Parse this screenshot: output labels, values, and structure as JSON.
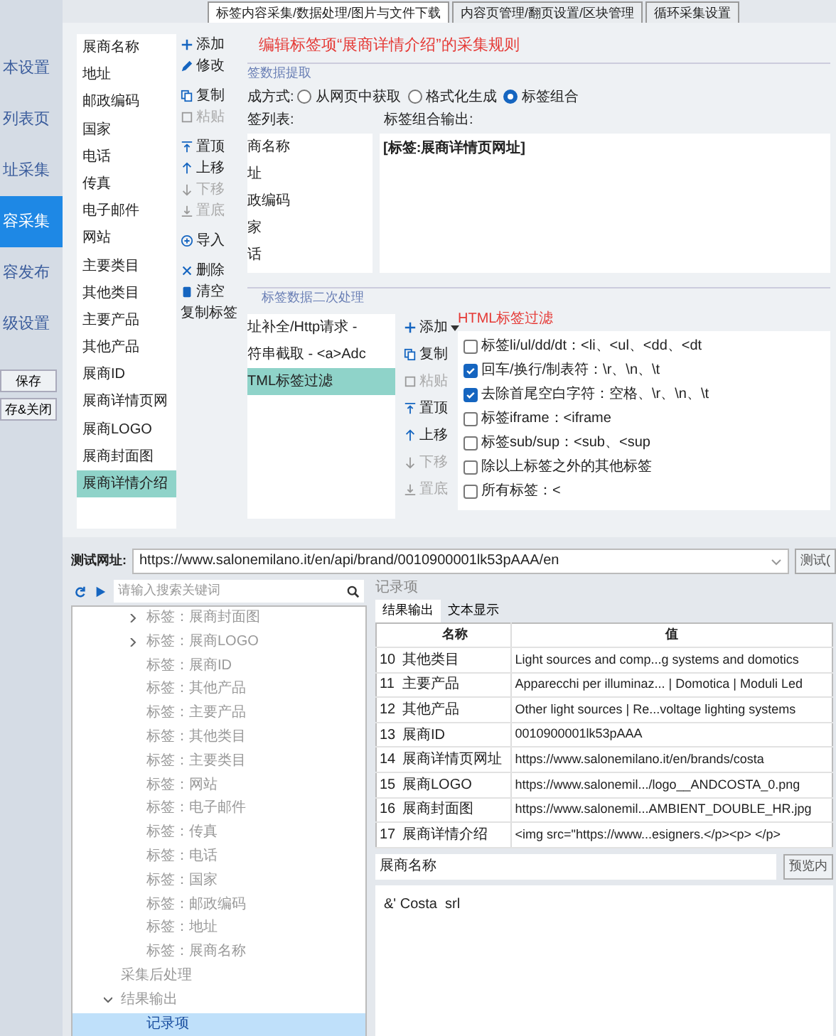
{
  "nav": {
    "items": [
      {
        "label": "本设置",
        "selected": false
      },
      {
        "label": "列表页",
        "selected": false
      },
      {
        "label": "址采集",
        "selected": false
      },
      {
        "label": "容采集",
        "selected": true
      },
      {
        "label": "容发布",
        "selected": false
      },
      {
        "label": "级设置",
        "selected": false
      }
    ],
    "buttons": [
      "保存",
      "存&关闭"
    ]
  },
  "tabs": [
    {
      "label": "标签内容采集/数据处理/图片与文件下载",
      "selected": true
    },
    {
      "label": "内容页管理/翻页设置/区块管理",
      "selected": false
    },
    {
      "label": "循环采集设置",
      "selected": false
    }
  ],
  "field_list": [
    {
      "label": "展商名称",
      "selected": false
    },
    {
      "label": "地址",
      "selected": false
    },
    {
      "label": "邮政编码",
      "selected": false
    },
    {
      "label": "国家",
      "selected": false
    },
    {
      "label": "电话",
      "selected": false
    },
    {
      "label": "传真",
      "selected": false
    },
    {
      "label": "电子邮件",
      "selected": false
    },
    {
      "label": "网站",
      "selected": false
    },
    {
      "label": "主要类目",
      "selected": false
    },
    {
      "label": "其他类目",
      "selected": false
    },
    {
      "label": "主要产品",
      "selected": false
    },
    {
      "label": "其他产品",
      "selected": false
    },
    {
      "label": "展商ID",
      "selected": false
    },
    {
      "label": "展商详情页网",
      "selected": false
    },
    {
      "label": "展商LOGO",
      "selected": false
    },
    {
      "label": "展商封面图",
      "selected": false
    },
    {
      "label": "展商详情介绍",
      "selected": true
    }
  ],
  "field_buttons": [
    {
      "label": "添加",
      "disabled": false
    },
    {
      "label": "修改",
      "disabled": false
    },
    {
      "label": "复制",
      "disabled": false
    },
    {
      "label": "粘贴",
      "disabled": true
    },
    {
      "label": "置顶",
      "disabled": false
    },
    {
      "label": "上移",
      "disabled": false
    },
    {
      "label": "下移",
      "disabled": true
    },
    {
      "label": "置底",
      "disabled": true
    },
    {
      "label": "导入",
      "disabled": false
    },
    {
      "label": "删除",
      "disabled": false
    },
    {
      "label": "清空",
      "disabled": false
    },
    {
      "label": "复制标签",
      "disabled": false
    }
  ],
  "rule_title": "编辑标签项“展商详情介绍”的采集规则",
  "extraction": {
    "legend": "签数据提取",
    "mode_label": "成方式:",
    "modes": [
      {
        "label": "从网页中获取",
        "selected": false
      },
      {
        "label": "格式化生成",
        "selected": false
      },
      {
        "label": "标签组合",
        "selected": true
      }
    ],
    "tag_list_label": "签列表:",
    "tag_list": [
      {
        "label": "商名称",
        "selected": false
      },
      {
        "label": "址",
        "selected": false
      },
      {
        "label": "政编码",
        "selected": false
      },
      {
        "label": "家",
        "selected": false
      },
      {
        "label": "话",
        "selected": false
      }
    ],
    "output_label": "标签组合输出:",
    "output": "[标签:展商详情页网址]"
  },
  "processing": {
    "legend": "标签数据二次处理",
    "steps": [
      {
        "label": "址补全/Http请求 -",
        "selected": false
      },
      {
        "label": "符串截取 - <a>Adc",
        "selected": false
      },
      {
        "label": "TML标签过滤",
        "selected": true
      }
    ],
    "buttons": [
      {
        "label": "添加",
        "disabled": false,
        "dropdown": true
      },
      {
        "label": "复制",
        "disabled": false,
        "dropdown": false
      },
      {
        "label": "粘贴",
        "disabled": true,
        "dropdown": false
      },
      {
        "label": "置顶",
        "disabled": false,
        "dropdown": false
      },
      {
        "label": "上移",
        "disabled": false,
        "dropdown": false
      },
      {
        "label": "下移",
        "disabled": true,
        "dropdown": false
      },
      {
        "label": "置底",
        "disabled": true,
        "dropdown": false
      }
    ],
    "filter_title": "HTML标签过滤",
    "filters": [
      {
        "label": "标签li/ul/dd/dt：<li、<ul、<dd、<dt",
        "checked": false
      },
      {
        "label": "回车/换行/制表符：\\r、\\n、\\t",
        "checked": true
      },
      {
        "label": "去除首尾空白字符：空格、\\r、\\n、\\t",
        "checked": true
      },
      {
        "label": "标签iframe：<iframe",
        "checked": false
      },
      {
        "label": "标签sub/sup：<sub、<sup",
        "checked": false
      },
      {
        "label": "除以上标签之外的其他标签",
        "checked": false
      },
      {
        "label": "所有标签：<",
        "checked": false
      }
    ]
  },
  "test": {
    "label": "测试网址:",
    "url": "https://www.salonemilano.it/en/api/brand/0010900001lk53pAAA/en",
    "button": "测试("
  },
  "search": {
    "placeholder": "请输入搜索关键词"
  },
  "tree": [
    {
      "label": "标签：展商封面图",
      "expanded": false,
      "selected": false
    },
    {
      "label": "标签：展商LOGO",
      "expanded": false,
      "selected": false
    },
    {
      "label": "标签：展商ID",
      "selected": false
    },
    {
      "label": "标签：其他产品",
      "selected": false
    },
    {
      "label": "标签：主要产品",
      "selected": false
    },
    {
      "label": "标签：其他类目",
      "selected": false
    },
    {
      "label": "标签：主要类目",
      "selected": false
    },
    {
      "label": "标签：网站",
      "selected": false
    },
    {
      "label": "标签：电子邮件",
      "selected": false
    },
    {
      "label": "标签：传真",
      "selected": false
    },
    {
      "label": "标签：电话",
      "selected": false
    },
    {
      "label": "标签：国家",
      "selected": false
    },
    {
      "label": "标签：邮政编码",
      "selected": false
    },
    {
      "label": "标签：地址",
      "selected": false
    },
    {
      "label": "标签：展商名称",
      "selected": false
    },
    {
      "label": "采集后处理",
      "selected": false,
      "top": true
    },
    {
      "label": "结果输出",
      "selected": false,
      "top": true,
      "expanded": true,
      "children": [
        {
          "label": "记录项",
          "selected": true
        }
      ]
    }
  ],
  "result": {
    "label": "记录项",
    "tabs": [
      {
        "label": "结果输出",
        "selected": true
      },
      {
        "label": "文本显示",
        "selected": false
      }
    ],
    "columns": [
      "",
      "名称",
      "值"
    ],
    "rows": [
      [
        "10",
        "其他类目",
        "Light sources and comp...g systems and domotics"
      ],
      [
        "11",
        "主要产品",
        "Apparecchi per illuminaz... | Domotica | Moduli Led"
      ],
      [
        "12",
        "其他产品",
        "Other light sources | Re...voltage lighting systems"
      ],
      [
        "13",
        "展商ID",
        "0010900001lk53pAAA"
      ],
      [
        "14",
        "展商详情页网址",
        "https://www.salonemilano.it/en/brands/costa"
      ],
      [
        "15",
        "展商LOGO",
        "https://www.salonemil.../logo__ANDCOSTA_0.png"
      ],
      [
        "16",
        "展商封面图",
        "https://www.salonemil...AMBIENT_DOUBLE_HR.jpg"
      ],
      [
        "17",
        "展商详情介绍",
        "<img src=\"https://www...esigners.</p><p> </p>"
      ]
    ],
    "field": "展商名称",
    "preview_button": "预览内",
    "text": "&' Costa  srl"
  }
}
